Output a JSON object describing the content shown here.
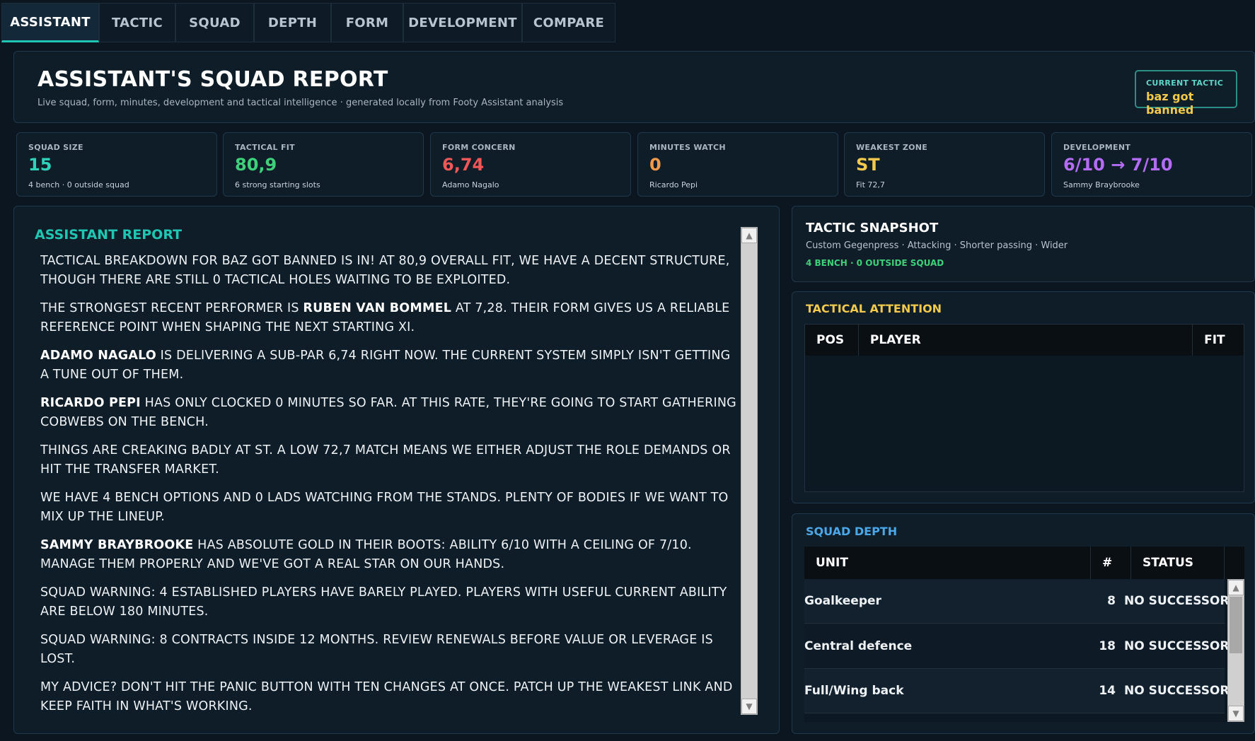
{
  "tabs": [
    {
      "label": "ASSISTANT"
    },
    {
      "label": "TACTIC"
    },
    {
      "label": "SQUAD"
    },
    {
      "label": "DEPTH"
    },
    {
      "label": "FORM"
    },
    {
      "label": "DEVELOPMENT"
    },
    {
      "label": "COMPARE"
    }
  ],
  "header": {
    "title": "ASSISTANT'S SQUAD REPORT",
    "subtitle": "Live squad, form, minutes, development and tactical intelligence · generated locally from Footy Assistant analysis",
    "current_tactic_label": "CURRENT TACTIC",
    "current_tactic_value": "baz got banned"
  },
  "stats": [
    {
      "label": "SQUAD SIZE",
      "value": "15",
      "note": "4 bench · 0 outside squad",
      "color": "#2fd1b8"
    },
    {
      "label": "TACTICAL FIT",
      "value": "80,9",
      "note": "6 strong starting slots",
      "color": "#3fd07a"
    },
    {
      "label": "FORM CONCERN",
      "value": "6,74",
      "note": "Adamo Nagalo",
      "color": "#f25757"
    },
    {
      "label": "MINUTES WATCH",
      "value": "0",
      "note": "Ricardo Pepi",
      "color": "#f2994a"
    },
    {
      "label": "WEAKEST ZONE",
      "value": "ST",
      "note": "Fit 72,7",
      "color": "#f2c94c"
    },
    {
      "label": "DEVELOPMENT",
      "value": "6/10 → 7/10",
      "note": "Sammy Braybrooke",
      "color": "#b46cf5"
    }
  ],
  "report": {
    "title": "ASSISTANT REPORT",
    "paragraphs": [
      {
        "bold": "",
        "text": "Tactical breakdown for baz got banned is in! At 80,9 overall fit, we have a decent structure, though there are still 0 tactical holes waiting to be exploited."
      },
      {
        "pre": "The strongest recent performer is ",
        "bold": "Ruben van Bommel",
        "text": " at 7,28. Their form gives us a reliable reference point when shaping the next starting XI."
      },
      {
        "pre": "",
        "bold": "Adamo Nagalo",
        "text": " is delivering a sub-par 6,74 right now. The current system simply isn't getting a tune out of them."
      },
      {
        "pre": "",
        "bold": "Ricardo Pepi",
        "text": " has only clocked 0 minutes so far. At this rate, they're going to start gathering cobwebs on the bench."
      },
      {
        "pre": "",
        "bold": "",
        "text": "Things are creaking badly at ST. A low 72,7 match means we either adjust the role demands or hit the transfer market."
      },
      {
        "pre": "",
        "bold": "",
        "text": "We have 4 bench options and 0 lads watching from the stands. Plenty of bodies if we want to mix up the lineup."
      },
      {
        "pre": "",
        "bold": "Sammy Braybrooke",
        "text": " has absolute gold in their boots: ability 6/10 with a ceiling of 7/10. Manage them properly and we've got a real star on our hands."
      },
      {
        "pre": "",
        "bold": "",
        "text": "Squad warning: 4 established players have barely played. Players with useful current ability are below 180 minutes."
      },
      {
        "pre": "",
        "bold": "",
        "text": "Squad warning: 8 contracts inside 12 months. Review renewals before value or leverage is lost."
      },
      {
        "pre": "",
        "bold": "",
        "text": "My advice? Don't hit the panic button with ten changes at once. Patch up the weakest link and keep faith in what's working."
      }
    ]
  },
  "snapshot": {
    "title": "TACTIC SNAPSHOT",
    "desc": "Custom Gegenpress · Attacking · Shorter passing · Wider",
    "note": "4 BENCH · 0 OUTSIDE SQUAD"
  },
  "attention": {
    "title": "TACTICAL ATTENTION",
    "columns": [
      "POS",
      "PLAYER",
      "FIT"
    ]
  },
  "depth": {
    "title": "SQUAD DEPTH",
    "columns": [
      "UNIT",
      "#",
      "STATUS"
    ],
    "rows": [
      {
        "unit": "Goalkeeper",
        "count": "8",
        "status": "NO SUCCESSOR"
      },
      {
        "unit": "Central defence",
        "count": "18",
        "status": "NO SUCCESSOR"
      },
      {
        "unit": "Full/Wing back",
        "count": "14",
        "status": "NO SUCCESSOR"
      }
    ]
  },
  "icons": {
    "scroll_up": "chevron-up-icon",
    "scroll_down": "chevron-down-icon"
  },
  "colors": {
    "accent_teal": "#1fc7b3",
    "section_yellow": "#f2c94c",
    "section_blue": "#4aa8e8",
    "green": "#3fd07a"
  }
}
